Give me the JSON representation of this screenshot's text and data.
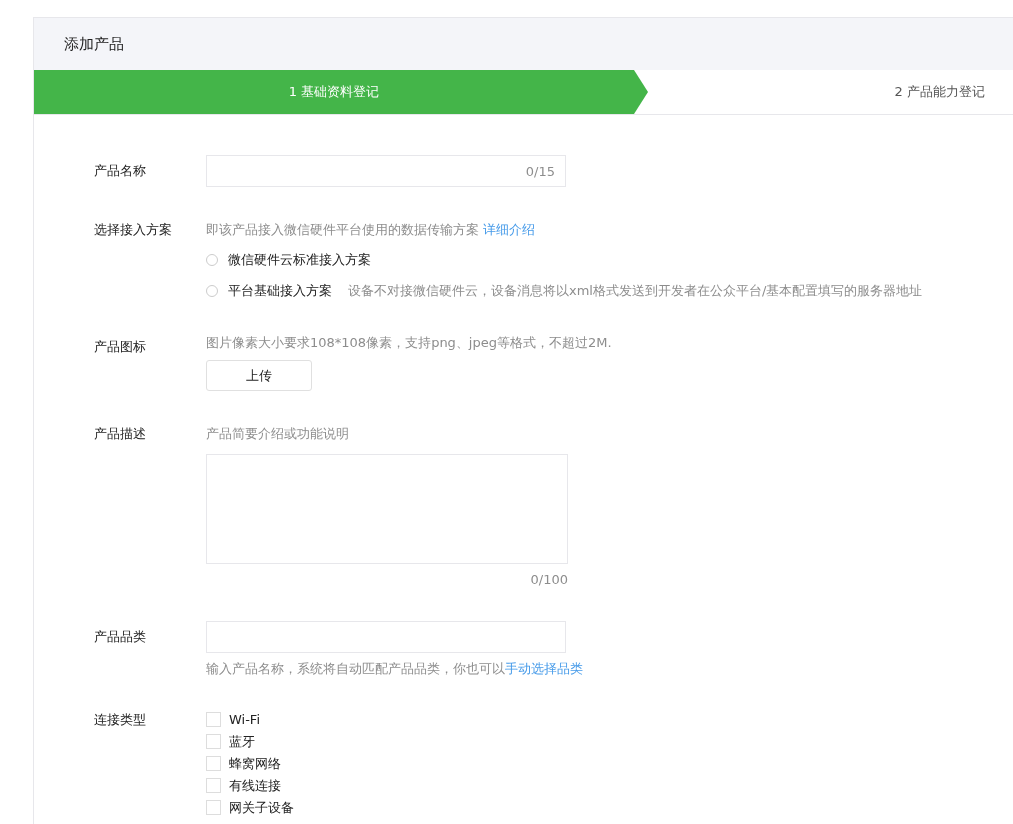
{
  "title": "添加产品",
  "steps": [
    {
      "label": "1 基础资料登记",
      "selected": true
    },
    {
      "label": "2 产品能力登记",
      "selected": false
    }
  ],
  "fields": [
    {
      "kind": "text",
      "label": "产品名称",
      "counter": "0/15"
    },
    {
      "kind": "radio",
      "label": "选择接入方案",
      "hint": "即该产品接入微信硬件平台使用的数据传输方案",
      "link": "详细介绍",
      "options": [
        {
          "label": "微信硬件云标准接入方案",
          "selected": false
        },
        {
          "label": "平台基础接入方案",
          "note": "设备不对接微信硬件云，设备消息将以xml格式发送到开发者在公众平台/基本配置填写的服务器地址",
          "selected": false
        }
      ]
    },
    {
      "kind": "upload",
      "label": "产品图标",
      "hint": "图片像素大小要求108*108像素，支持png、jpeg等格式，不超过2M.",
      "button": "上传"
    },
    {
      "kind": "textarea",
      "label": "产品描述",
      "hint": "产品简要介绍或功能说明",
      "counter": "0/100"
    },
    {
      "kind": "category",
      "label": "产品品类",
      "hint": "输入产品名称，系统将自动匹配产品品类，你也可以",
      "link": "手动选择品类"
    },
    {
      "kind": "checkbox",
      "label": "连接类型",
      "options": [
        {
          "label": "Wi-Fi",
          "checked": false
        },
        {
          "label": "蓝牙",
          "checked": false
        },
        {
          "label": "蜂窝网络",
          "checked": false
        },
        {
          "label": "有线连接",
          "checked": false
        },
        {
          "label": "网关子设备",
          "checked": false
        }
      ]
    }
  ]
}
